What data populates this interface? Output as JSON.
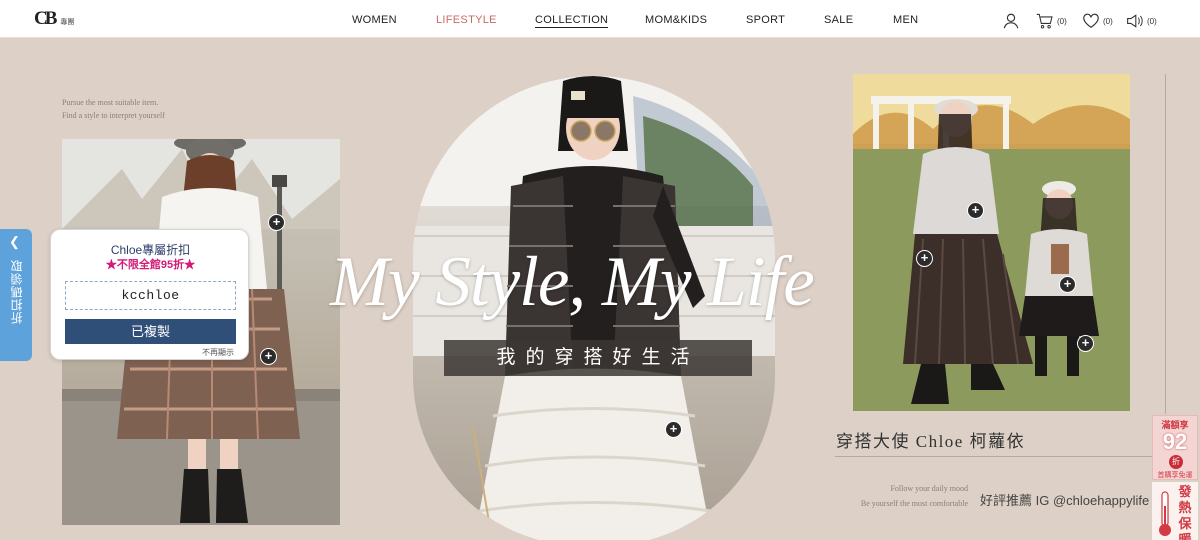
{
  "logo": {
    "mark": "CB",
    "sub": "專團"
  },
  "nav": {
    "items": [
      {
        "label": "WOMEN"
      },
      {
        "label": "LIFESTYLE"
      },
      {
        "label": "COLLECTION"
      },
      {
        "label": "MOM&KIDS"
      },
      {
        "label": "SPORT"
      },
      {
        "label": "SALE"
      },
      {
        "label": "MEN"
      }
    ]
  },
  "header_icons": {
    "account": {
      "icon": "user-icon"
    },
    "cart": {
      "icon": "cart-icon",
      "count": "(0)"
    },
    "wishlist": {
      "icon": "heart-icon",
      "count": "(0)"
    },
    "notifications": {
      "icon": "speaker-icon",
      "count": "(0)"
    }
  },
  "hero": {
    "left_text": [
      "Pursue the most suitable item.",
      "Find a style to interpret yourself"
    ],
    "headline": "My Style, My Life",
    "subheadline": "我的穿搭好生活",
    "ambassador": "穿搭大使 Chloe 柯蘿依",
    "follow_text": [
      "Follow your daily mood",
      "Be yourself the most comfortable"
    ],
    "ig_text": "好評推薦 IG @chloehappylife"
  },
  "coupon": {
    "tab_label": "折扣碼領取",
    "title": "Chloe專屬折扣",
    "subtitle": "★不限全館95折★",
    "code": "kcchloe",
    "button": "已複製",
    "dismiss": "不再顯示"
  },
  "promo": {
    "top": "滿額享",
    "number": "92",
    "tag": "折",
    "bottom": "首購享免運",
    "heat": "發熱保暖"
  },
  "colors": {
    "hero_bg": "#ddd0c6",
    "nav_active": "#c96a6a",
    "coupon_blue": "#2f4e78",
    "tab_blue": "#5ea2dc",
    "promo_red": "#d23a44"
  }
}
